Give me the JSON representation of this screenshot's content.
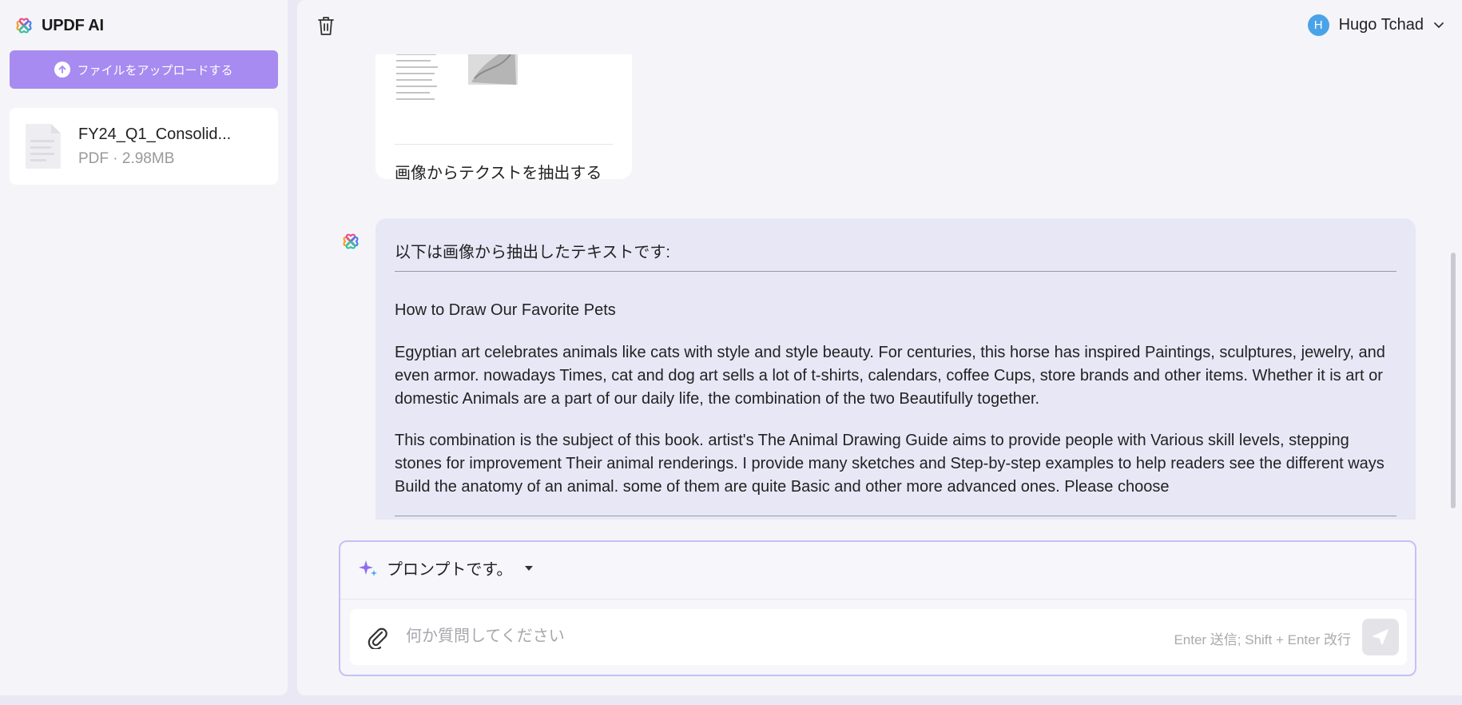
{
  "app": {
    "title": "UPDF AI"
  },
  "sidebar": {
    "upload_label": "ファイルをアップロードする",
    "files": [
      {
        "name": "FY24_Q1_Consolid...",
        "meta": "PDF · 2.98MB"
      }
    ]
  },
  "header": {
    "user_initial": "H",
    "user_name": "Hugo Tchad"
  },
  "chat": {
    "image_caption": "画像からテクストを抽出する",
    "response": {
      "intro": "以下は画像から抽出したテキストです:",
      "heading": "How to Draw Our Favorite Pets",
      "paragraph1": "Egyptian art celebrates animals like cats with style and style beauty. For centuries, this horse has inspired Paintings, sculptures, jewelry, and even armor. nowadays Times, cat and dog art sells a lot of t-shirts, calendars, coffee Cups, store brands and other items. Whether it is art or domestic Animals are a part of our daily life, the combination of the two Beautifully together.",
      "paragraph2": "This combination is the subject of this book. artist's The Animal Drawing Guide aims to provide people with Various skill levels, stepping stones for improvement Their animal renderings. I provide many sketches and Step-by-step examples to help readers see the different ways Build the anatomy of an animal. some of them are quite Basic and other more advanced ones. Please choose"
    }
  },
  "composer": {
    "prompt_label": "プロンプトです。",
    "placeholder": "何か質問してください",
    "hint": "Enter 送信; Shift + Enter 改行"
  },
  "colors": {
    "accent": "#a78bf0",
    "composer_border": "#c5c0f5",
    "bot_bubble": "#e8e7f6"
  },
  "icons": [
    "updf-logo-icon",
    "upload-arrow-icon",
    "file-icon",
    "trash-icon",
    "chevron-down-icon",
    "sparkle-icon",
    "paperclip-icon",
    "send-icon"
  ]
}
